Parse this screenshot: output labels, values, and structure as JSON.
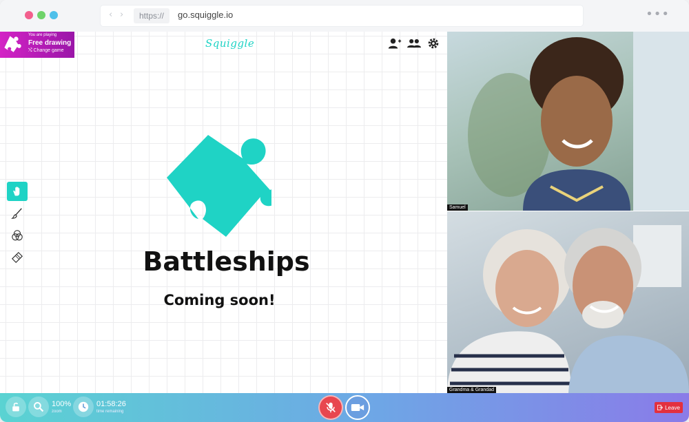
{
  "browser": {
    "protocol": "https://",
    "url": "go.squiggle.io",
    "more_icon": "more-dots-icon"
  },
  "header": {
    "logo_text": "Squiggle",
    "icons": [
      "add-user-icon",
      "people-icon",
      "gear-icon"
    ]
  },
  "game_badge": {
    "caption": "You are playing",
    "title": "Free drawing",
    "change_label": "Change game",
    "icon": "puzzle-icon"
  },
  "tools": [
    "hand-icon",
    "brush-icon",
    "color-circles-icon",
    "eraser-icon"
  ],
  "main": {
    "title": "Battleships",
    "subtitle": "Coming soon!",
    "icon": "puzzle-icon",
    "accent_color": "#1fd3c5"
  },
  "videos": [
    {
      "name": "Samuel"
    },
    {
      "name": "Grandma & Grandad"
    }
  ],
  "bottombar": {
    "zoom_value": "100%",
    "zoom_label": "zoom",
    "time_value": "01:58:26",
    "time_label": "time remaining",
    "leave_label": "Leave",
    "mic_color": "#e8464f",
    "leave_color": "#e3303f"
  }
}
